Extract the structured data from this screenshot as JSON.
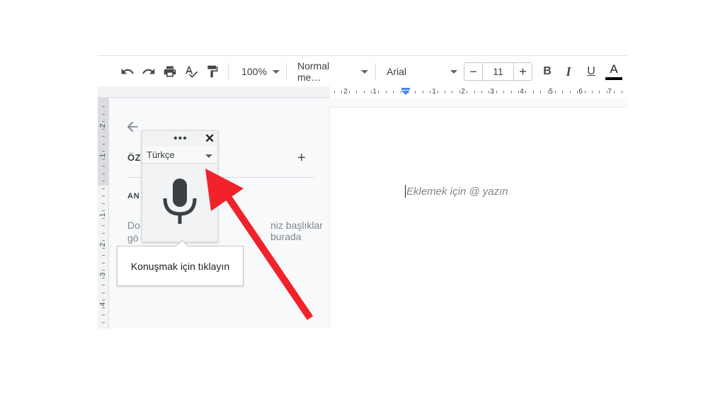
{
  "toolbar": {
    "zoom": "100%",
    "style": "Normal me…",
    "font": "Arial",
    "size_minus": "−",
    "size_value": "11",
    "size_plus": "+",
    "bold": "B",
    "italic": "I",
    "underline": "U",
    "text_color": "A"
  },
  "rulers": {
    "horizontal": [
      "2",
      "1",
      "1",
      "2",
      "3",
      "4",
      "5",
      "6",
      "7"
    ],
    "vertical": [
      "2",
      "1",
      "1",
      "2",
      "3",
      "4"
    ]
  },
  "outline": {
    "summary_label": "ÖZ",
    "add": "+",
    "headings_label": "AN",
    "empty_line1": "Do",
    "empty_line2": "gö",
    "empty_tail": "niz başlıklar burada"
  },
  "voice": {
    "menu": "•••",
    "close": "✕",
    "language": "Türkçe"
  },
  "tooltip": {
    "text": "Konuşmak için tıklayın"
  },
  "document": {
    "placeholder": "Eklemek için @ yazın"
  },
  "colors": {
    "annotation_arrow": "#f2222a",
    "ruler_marker": "#4285f4"
  }
}
